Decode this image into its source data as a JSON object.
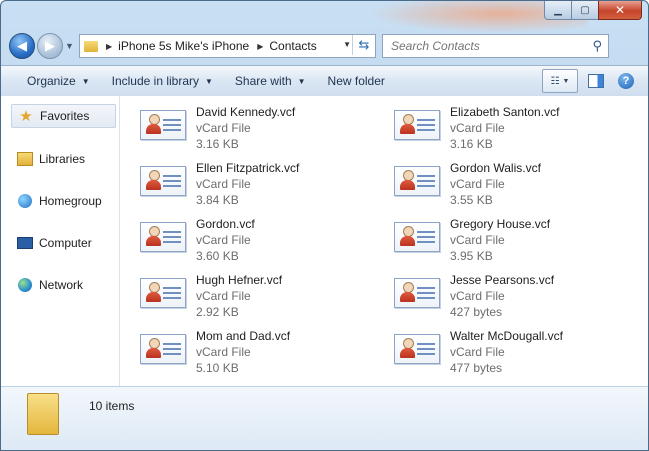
{
  "breadcrumbs": [
    "iPhone 5s Mike's iPhone",
    "Contacts"
  ],
  "search": {
    "placeholder": "Search Contacts"
  },
  "toolbar": {
    "organize": "Organize",
    "include": "Include in library",
    "share": "Share with",
    "new_folder": "New folder"
  },
  "nav": [
    {
      "label": "Favorites",
      "icon": "star-icon"
    },
    {
      "label": "Libraries",
      "icon": "libraries-icon"
    },
    {
      "label": "Homegroup",
      "icon": "homegroup-icon"
    },
    {
      "label": "Computer",
      "icon": "computer-icon"
    },
    {
      "label": "Network",
      "icon": "network-icon"
    }
  ],
  "files": [
    {
      "name": "David Kennedy.vcf",
      "type": "vCard File",
      "size": "3.16 KB"
    },
    {
      "name": "Elizabeth Santon.vcf",
      "type": "vCard File",
      "size": "3.16 KB"
    },
    {
      "name": "Ellen Fitzpatrick.vcf",
      "type": "vCard File",
      "size": "3.84 KB"
    },
    {
      "name": "Gordon Walis.vcf",
      "type": "vCard File",
      "size": "3.55 KB"
    },
    {
      "name": "Gordon.vcf",
      "type": "vCard File",
      "size": "3.60 KB"
    },
    {
      "name": "Gregory House.vcf",
      "type": "vCard File",
      "size": "3.95 KB"
    },
    {
      "name": "Hugh Hefner.vcf",
      "type": "vCard File",
      "size": "2.92 KB"
    },
    {
      "name": "Jesse Pearsons.vcf",
      "type": "vCard File",
      "size": "427 bytes"
    },
    {
      "name": "Mom and Dad.vcf",
      "type": "vCard File",
      "size": "5.10 KB"
    },
    {
      "name": "Walter McDougall.vcf",
      "type": "vCard File",
      "size": "477 bytes"
    }
  ],
  "details": {
    "count": "10 items"
  },
  "colors": {
    "accent": "#2a6fc6",
    "close": "#c6452c"
  }
}
